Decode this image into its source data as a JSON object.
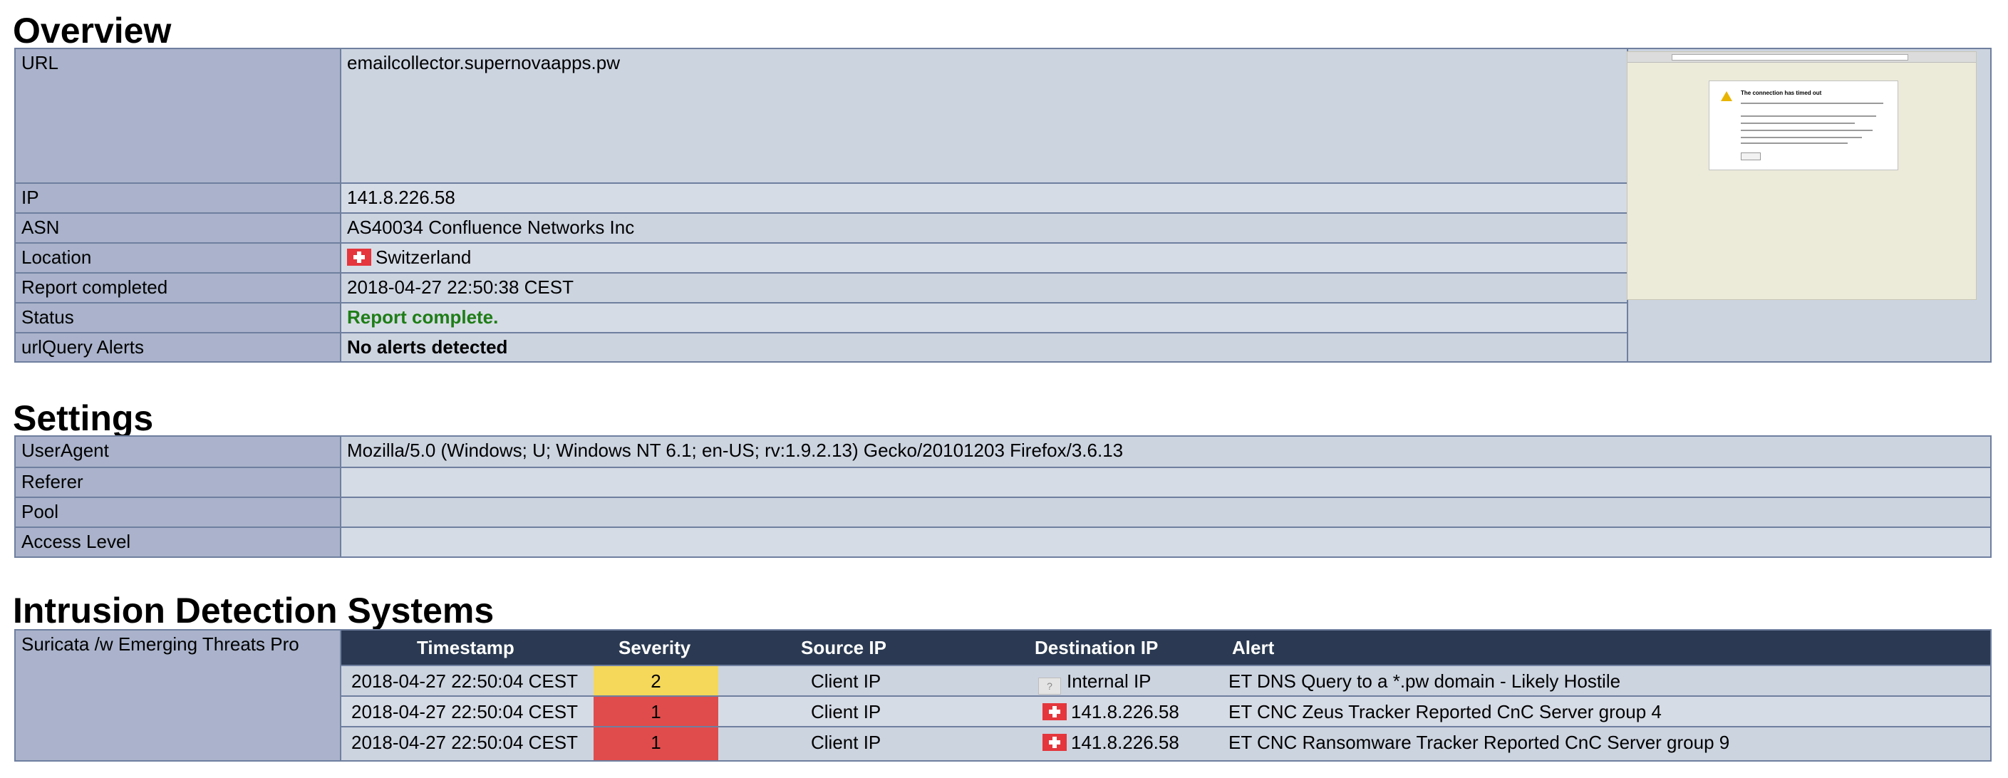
{
  "overview": {
    "title": "Overview",
    "rows": {
      "url": {
        "label": "URL",
        "value": "emailcollector.supernovaapps.pw"
      },
      "ip": {
        "label": "IP",
        "value": "141.8.226.58"
      },
      "asn": {
        "label": "ASN",
        "value": "AS40034 Confluence Networks Inc"
      },
      "location": {
        "label": "Location",
        "value": "Switzerland",
        "flag": "swiss-flag-icon"
      },
      "report_completed": {
        "label": "Report completed",
        "value": "2018-04-27 22:50:38 CEST"
      },
      "status": {
        "label": "Status",
        "value": "Report complete.",
        "color": "#1e7d16"
      },
      "alerts": {
        "label": "urlQuery Alerts",
        "value": "No alerts detected"
      }
    },
    "screenshot": {
      "dialog_title": "The connection has timed out"
    }
  },
  "settings": {
    "title": "Settings",
    "rows": [
      {
        "label": "UserAgent",
        "value": "Mozilla/5.0 (Windows; U; Windows NT 6.1; en-US; rv:1.9.2.13) Gecko/20101203 Firefox/3.6.13"
      },
      {
        "label": "Referer",
        "value": ""
      },
      {
        "label": "Pool",
        "value": ""
      },
      {
        "label": "Access Level",
        "value": ""
      }
    ]
  },
  "ids": {
    "title": "Intrusion Detection Systems",
    "engine": "Suricata /w Emerging Threats Pro",
    "columns": [
      "Timestamp",
      "Severity",
      "Source IP",
      "Destination IP",
      "Alert"
    ],
    "rows": [
      {
        "timestamp": "2018-04-27 22:50:04 CEST",
        "severity": "2",
        "source": "Client IP",
        "dest": "Internal IP",
        "dest_icon": "unknown-flag-icon",
        "alert": "ET DNS Query to a *.pw domain - Likely Hostile"
      },
      {
        "timestamp": "2018-04-27 22:50:04 CEST",
        "severity": "1",
        "source": "Client IP",
        "dest": "141.8.226.58",
        "dest_icon": "swiss-flag-icon",
        "alert": "ET CNC Zeus Tracker Reported CnC Server group 4"
      },
      {
        "timestamp": "2018-04-27 22:50:04 CEST",
        "severity": "1",
        "source": "Client IP",
        "dest": "141.8.226.58",
        "dest_icon": "swiss-flag-icon",
        "alert": "ET CNC Ransomware Tracker Reported CnC Server group 9"
      }
    ]
  },
  "colors": {
    "label_bg": "#aab3cb",
    "value_bg": "#ccd4e0",
    "header_bg": "#2b3a52",
    "severity_2": "#f5d85a",
    "severity_1": "#e04c4c"
  }
}
